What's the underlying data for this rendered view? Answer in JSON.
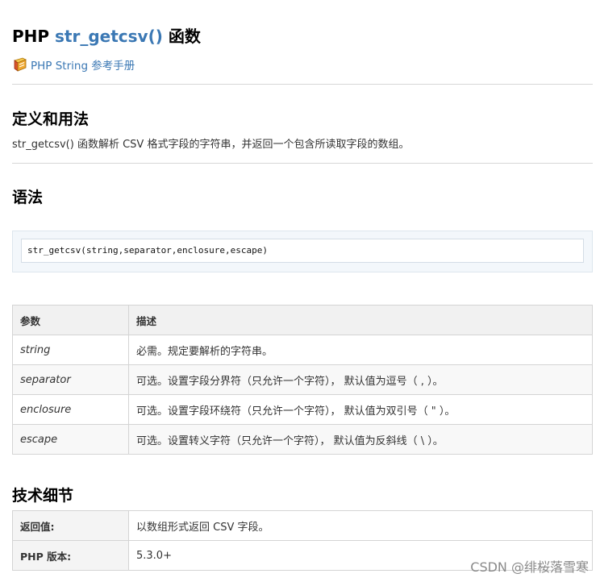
{
  "header": {
    "title_prefix": "PHP ",
    "title_fn": "str_getcsv()",
    "title_suffix": " 函数",
    "ref_link": "PHP String 参考手册"
  },
  "definition": {
    "heading": "定义和用法",
    "text": "str_getcsv() 函数解析 CSV 格式字段的字符串，并返回一个包含所读取字段的数组。"
  },
  "syntax": {
    "heading": "语法",
    "code": "str_getcsv(string,separator,enclosure,escape)"
  },
  "params": {
    "headers": [
      "参数",
      "描述"
    ],
    "rows": [
      {
        "name": "string",
        "desc": "必需。规定要解析的字符串。"
      },
      {
        "name": "separator",
        "desc": "可选。设置字段分界符（只允许一个字符）， 默认值为逗号（ , ）。"
      },
      {
        "name": "enclosure",
        "desc": "可选。设置字段环绕符（只允许一个字符）， 默认值为双引号（ \" ）。"
      },
      {
        "name": "escape",
        "desc": "可选。设置转义字符（只允许一个字符）， 默认值为反斜线（ \\ ）。"
      }
    ]
  },
  "tech": {
    "heading": "技术细节",
    "rows": [
      {
        "key": "返回值:",
        "value": "以数组形式返回 CSV 字段。"
      },
      {
        "key": "PHP 版本:",
        "value": "5.3.0+"
      }
    ]
  },
  "watermark": "CSDN @绯桜落雪寒",
  "icons": {
    "ref_link": "book-icon"
  }
}
